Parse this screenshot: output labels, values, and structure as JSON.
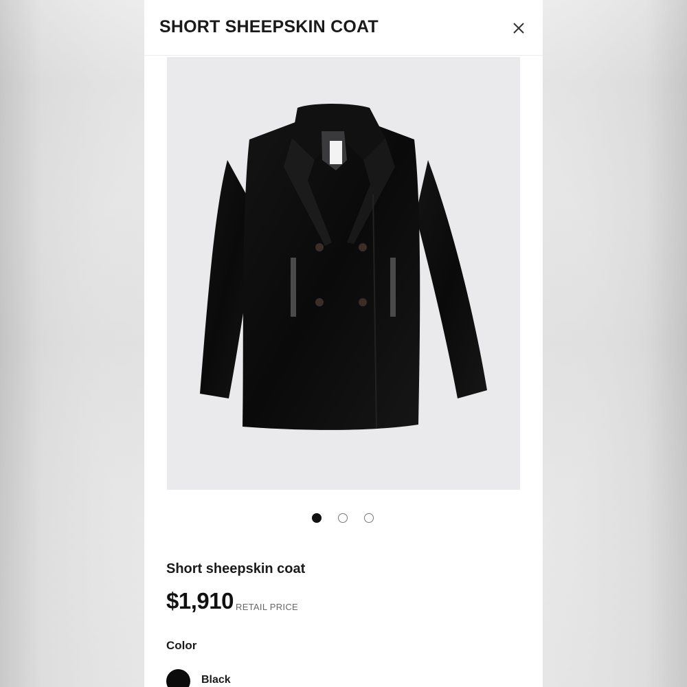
{
  "header": {
    "title": "SHORT SHEEPSKIN COAT",
    "close_icon": "close-icon"
  },
  "gallery": {
    "image_subject": "coat-image",
    "dots": [
      {
        "state": "active"
      },
      {
        "state": "inactive"
      },
      {
        "state": "inactive"
      }
    ]
  },
  "product": {
    "name": "Short sheepskin coat",
    "price": "$1,910",
    "price_label": "RETAIL PRICE"
  },
  "color": {
    "label": "Color",
    "selected": "Black",
    "swatch_hex": "#0b0b0b"
  },
  "colors": {
    "image_bg": "#eaeaec",
    "text": "#1a1a1a",
    "muted": "#666666"
  }
}
